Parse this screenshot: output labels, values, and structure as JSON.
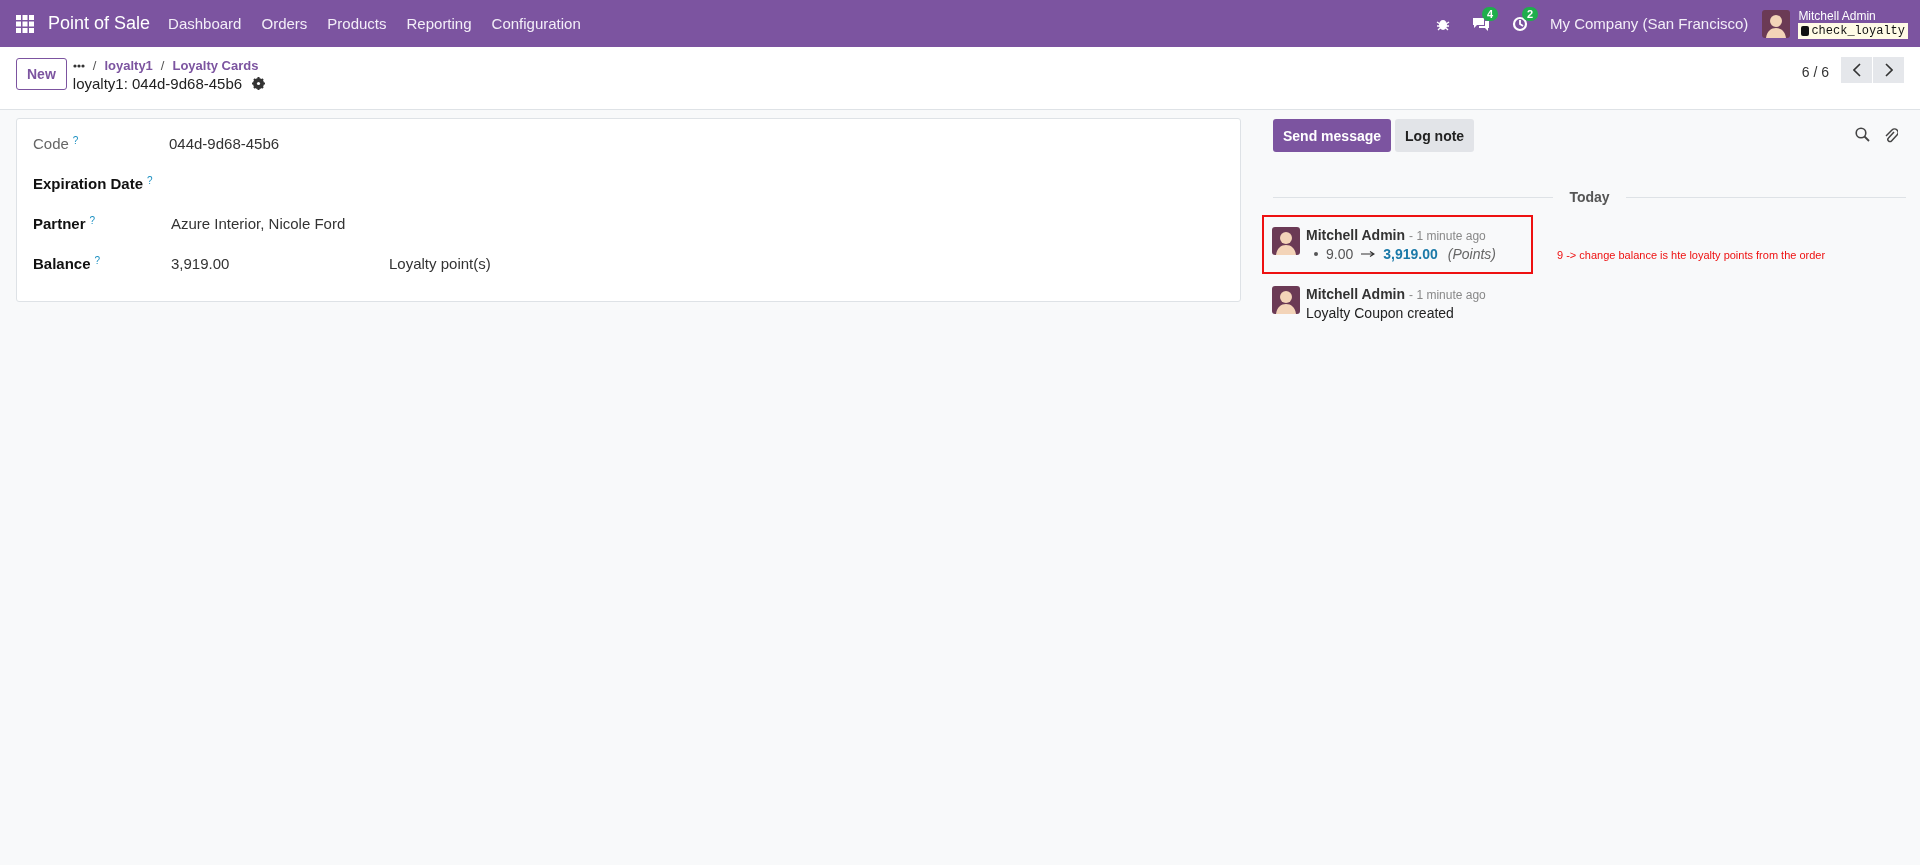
{
  "navbar": {
    "app_title": "Point of Sale",
    "menu": [
      "Dashboard",
      "Orders",
      "Products",
      "Reporting",
      "Configuration"
    ],
    "messages_badge": "4",
    "activities_badge": "2",
    "company": "My Company (San Francisco)",
    "user_name": "Mitchell Admin",
    "database": "check_loyalty"
  },
  "control_panel": {
    "new_button": "New",
    "breadcrumbs": [
      {
        "separator": "/",
        "label": "loyalty1"
      },
      {
        "separator": "/",
        "label": "Loyalty Cards"
      }
    ],
    "record_title": "loyalty1: 044d-9d68-45b6",
    "pager": "6 / 6"
  },
  "form": {
    "fields": [
      {
        "label": "Code",
        "help_mark": "?",
        "value": "044d-9d68-45b6",
        "readonly": true
      },
      {
        "label": "Expiration Date",
        "help_mark": "?",
        "readonly": false
      },
      {
        "label": "Partner",
        "help_mark": "?",
        "value": "Azure Interior, Nicole Ford",
        "readonly": false
      },
      {
        "label": "Balance",
        "help_mark": "?",
        "value": "3,919.00",
        "unit": "Loyalty point(s)",
        "readonly": false
      }
    ]
  },
  "chatter": {
    "buttons": [
      {
        "label": "Send message",
        "primary": true
      },
      {
        "label": "Log note",
        "primary": false
      }
    ],
    "date_separator": "Today",
    "messages": [
      {
        "kind": "tracking",
        "author": "Mitchell Admin",
        "time": "- 1 minute ago",
        "old_value": "9.00",
        "new_value": "3,919.00",
        "field": "(Points)",
        "highlighted": true
      },
      {
        "kind": "text",
        "author": "Mitchell Admin",
        "time": "- 1 minute ago",
        "body": "Loyalty Coupon created",
        "highlighted": false
      }
    ],
    "annotation": "9 -> change balance is hte loyalty points from the order"
  }
}
